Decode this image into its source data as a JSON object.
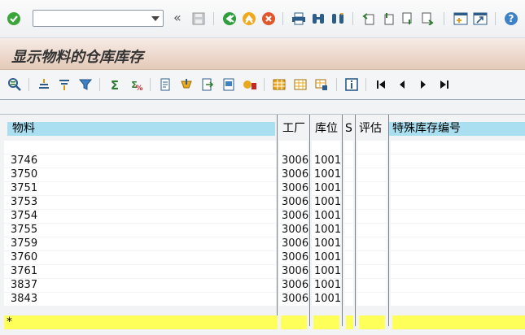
{
  "toolbar": {
    "command_field_value": "",
    "double_arrow": "«"
  },
  "title": "显示物料的仓库库存",
  "table": {
    "headers": [
      "物料",
      "工厂",
      "库位",
      "S",
      "评估",
      "特殊库存编号"
    ],
    "rows": [
      [
        "",
        "",
        "",
        "",
        "",
        ""
      ],
      [
        "3746",
        "3006",
        "1001",
        "",
        "",
        ""
      ],
      [
        "3750",
        "3006",
        "1001",
        "",
        "",
        ""
      ],
      [
        "3751",
        "3006",
        "1001",
        "",
        "",
        ""
      ],
      [
        "3753",
        "3006",
        "1001",
        "",
        "",
        ""
      ],
      [
        "3754",
        "3006",
        "1001",
        "",
        "",
        ""
      ],
      [
        "3755",
        "3006",
        "1001",
        "",
        "",
        ""
      ],
      [
        "3759",
        "3006",
        "1001",
        "",
        "",
        ""
      ],
      [
        "3760",
        "3006",
        "1001",
        "",
        "",
        ""
      ],
      [
        "3761",
        "3006",
        "1001",
        "",
        "",
        ""
      ],
      [
        "3837",
        "3006",
        "1001",
        "",
        "",
        ""
      ],
      [
        "3843",
        "3006",
        "1001",
        "",
        "",
        ""
      ]
    ],
    "total_marker": "*"
  },
  "colors": {
    "header_bg": "#a9dff0",
    "total_bg": "#ffff5a",
    "title_bg": "#ecd7ca"
  }
}
